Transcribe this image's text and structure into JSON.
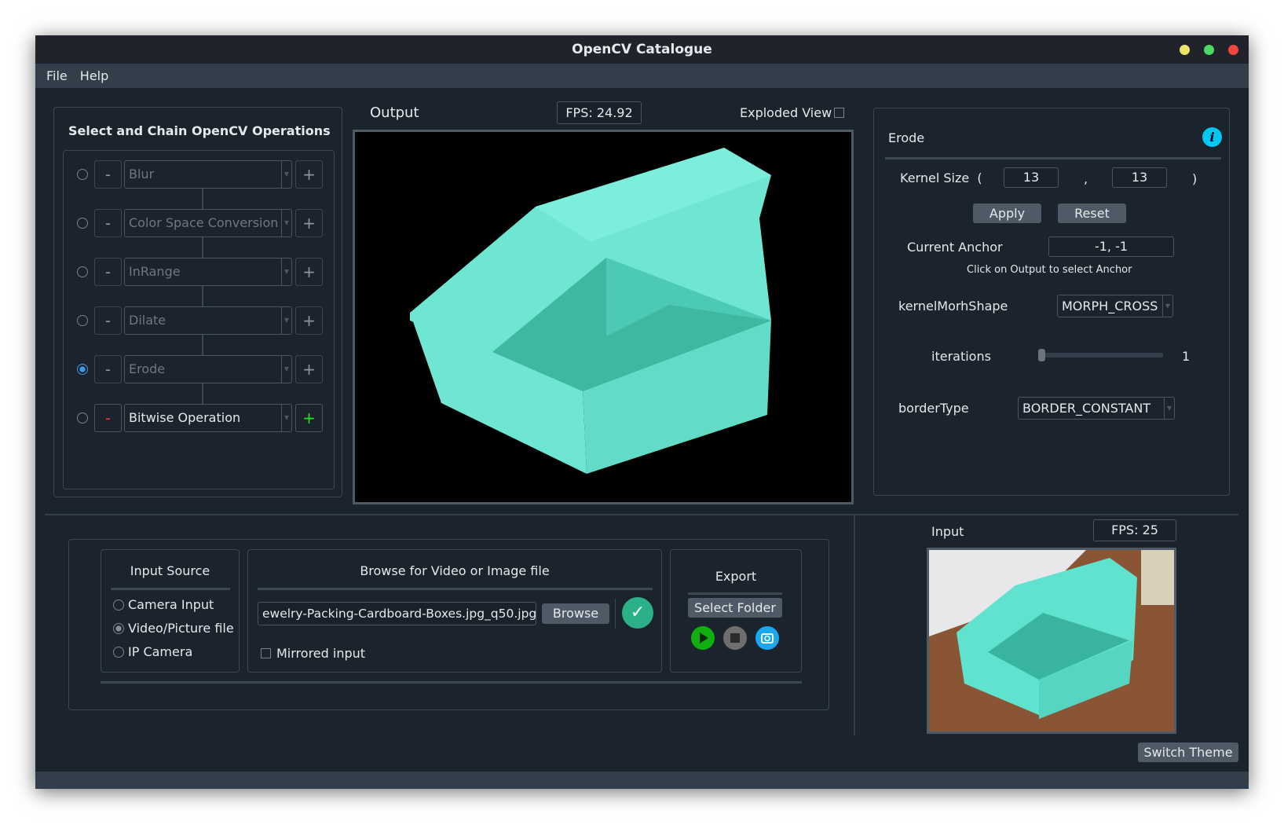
{
  "window": {
    "title": "OpenCV Catalogue"
  },
  "menu": [
    "File",
    "Help"
  ],
  "operations": {
    "title": "Select and Chain OpenCV Operations",
    "items": [
      {
        "label": "Blur",
        "selected": false,
        "active": false
      },
      {
        "label": "Color Space Conversion",
        "selected": false,
        "active": false
      },
      {
        "label": "InRange",
        "selected": false,
        "active": false
      },
      {
        "label": "Dilate",
        "selected": false,
        "active": false
      },
      {
        "label": "Erode",
        "selected": true,
        "active": false
      },
      {
        "label": "Bitwise Operation",
        "selected": false,
        "active": true
      }
    ],
    "minus": "-",
    "plus": "+"
  },
  "output": {
    "label": "Output",
    "fps": "FPS: 24.92",
    "exploded_label": "Exploded View",
    "exploded_checked": false
  },
  "params": {
    "title": "Erode",
    "kernel_label": "Kernel Size",
    "kernel_open": "(",
    "kernel_comma": ",",
    "kernel_close": ")",
    "kernel_w": "13",
    "kernel_h": "13",
    "apply": "Apply",
    "reset": "Reset",
    "anchor_label": "Current Anchor",
    "anchor_value": "-1, -1",
    "anchor_hint": "Click on Output to select Anchor",
    "shape_label": "kernelMorhShape",
    "shape_value": "MORPH_CROSS",
    "iterations_label": "iterations",
    "iterations_value": "1",
    "border_label": "borderType",
    "border_value": "BORDER_CONSTANT"
  },
  "input_source": {
    "title": "Input Source",
    "options": [
      "Camera Input",
      "Video/Picture file",
      "IP Camera"
    ],
    "selected": 1
  },
  "browse": {
    "title": "Browse for Video or Image file",
    "file": "ewelry-Packing-Cardboard-Boxes.jpg_q50.jpg",
    "button": "Browse",
    "mirrored": "Mirrored input"
  },
  "export": {
    "title": "Export",
    "select_folder": "Select Folder"
  },
  "input": {
    "label": "Input",
    "fps": "FPS: 25"
  },
  "switch_theme": "Switch Theme",
  "colors": {
    "accent": "#00c8f0",
    "teal": "#5fe3cf",
    "ok": "#2bb08a",
    "play": "#10b010"
  }
}
